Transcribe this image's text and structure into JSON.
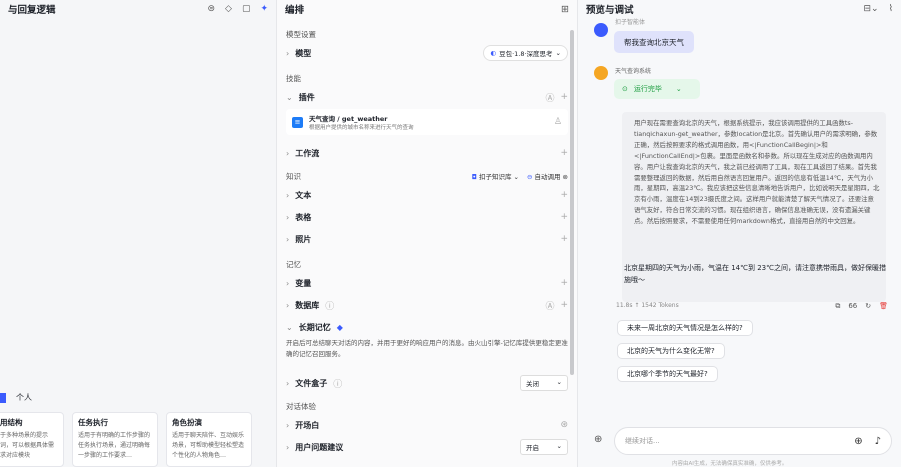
{
  "left": {
    "title": "与回复逻辑",
    "tab_active_label": "个人",
    "cards": [
      {
        "title": "用结构",
        "desc": "于多种场景的提示词，可以根据具体需求对应模块"
      },
      {
        "title": "任务执行",
        "desc": "适用于有明确的工作步骤的任务执行场景，通过明确每一步骤的工作要求…"
      },
      {
        "title": "角色扮演",
        "desc": "适用于聊天陪伴、互动娱乐场景，可帮助模型轻松塑造个性化的人物角色…"
      }
    ]
  },
  "middle": {
    "title": "编排",
    "model_settings_label": "模型设置",
    "model_label": "模型",
    "model_value": "豆包·1.8·深度思考",
    "skills_label": "技能",
    "plugin_label": "插件",
    "plugin_name": "天气查询 / get_weather",
    "plugin_desc": "根据用户提供的城市名称来进行天气的查询",
    "workflow_label": "工作流",
    "knowledge_label": "知识",
    "knowledge_base_label": "扣子知识库",
    "auto_call_label": "自动调用",
    "text_label": "文本",
    "table_label": "表格",
    "photo_label": "照片",
    "memory_label": "记忆",
    "variable_label": "变量",
    "database_label": "数据库",
    "long_memory_label": "长期记忆",
    "long_memory_desc": "开启后可总结聊天对话的内容，并用于更好的响应用户的消息。由火山引擎-记忆库提供更稳定更准确的记忆召回服务。",
    "filebox_label": "文件盒子",
    "filebox_value": "关闭",
    "dialog_exp_label": "对话体验",
    "opening_label": "开场白",
    "next_label": "用户问题建议",
    "next_value": "开启"
  },
  "right": {
    "title": "预览与调试",
    "user_name": "扣子智能体",
    "user_msg": "帮我查询北京天气",
    "bot_name": "天气查询系统",
    "status": "运行完毕",
    "reasoning": "用户现在需要查询北京的天气，根据系统提示，我应该调用提供的工具函数ts-tianqichaxun-get_weather，参数location是北京。首先确认用户的需求明确，参数正确，然后按照要求的格式调用函数，用<|FunctionCallBegin|>和<|FunctionCallEnd|>包裹。里面是函数名和参数。所以现在生成对应的函数调用内容。用户让我查询北京的天气，我之前已经调用了工具，现在工具返回了结果。首先我需要整理返回的数据，然后用自然语言回复用户。返回的信息有低温14℃，天气为小雨，星期四，高温23℃。我应该把这些信息清晰地告诉用户，比如说明天是星期四，北京有小雨，温度在14到23摄氏度之间。这样用户就能清楚了解天气情况了。还要注意语气友好，符合日常交流的习惯。现在组织语言，确保信息准确无误，没有遗漏关键点。然后按照要求，不需要使用任何markdown格式，直接用自然的中文回复。",
    "answer": "北京星期四的天气为小雨，气温在 14℃到 23℃之间，请注意携带雨具，做好保暖措施哦～",
    "meta_time": "11.8s",
    "meta_tokens": "1542 Tokens",
    "suggestions": [
      "未来一周北京的天气情况是怎么样的?",
      "北京的天气为什么变化无常?",
      "北京哪个季节的天气最好?"
    ],
    "input_placeholder": "继续对话...",
    "disclaimer": "内容由AI生成，无法确保真实准确，仅供参考。"
  }
}
